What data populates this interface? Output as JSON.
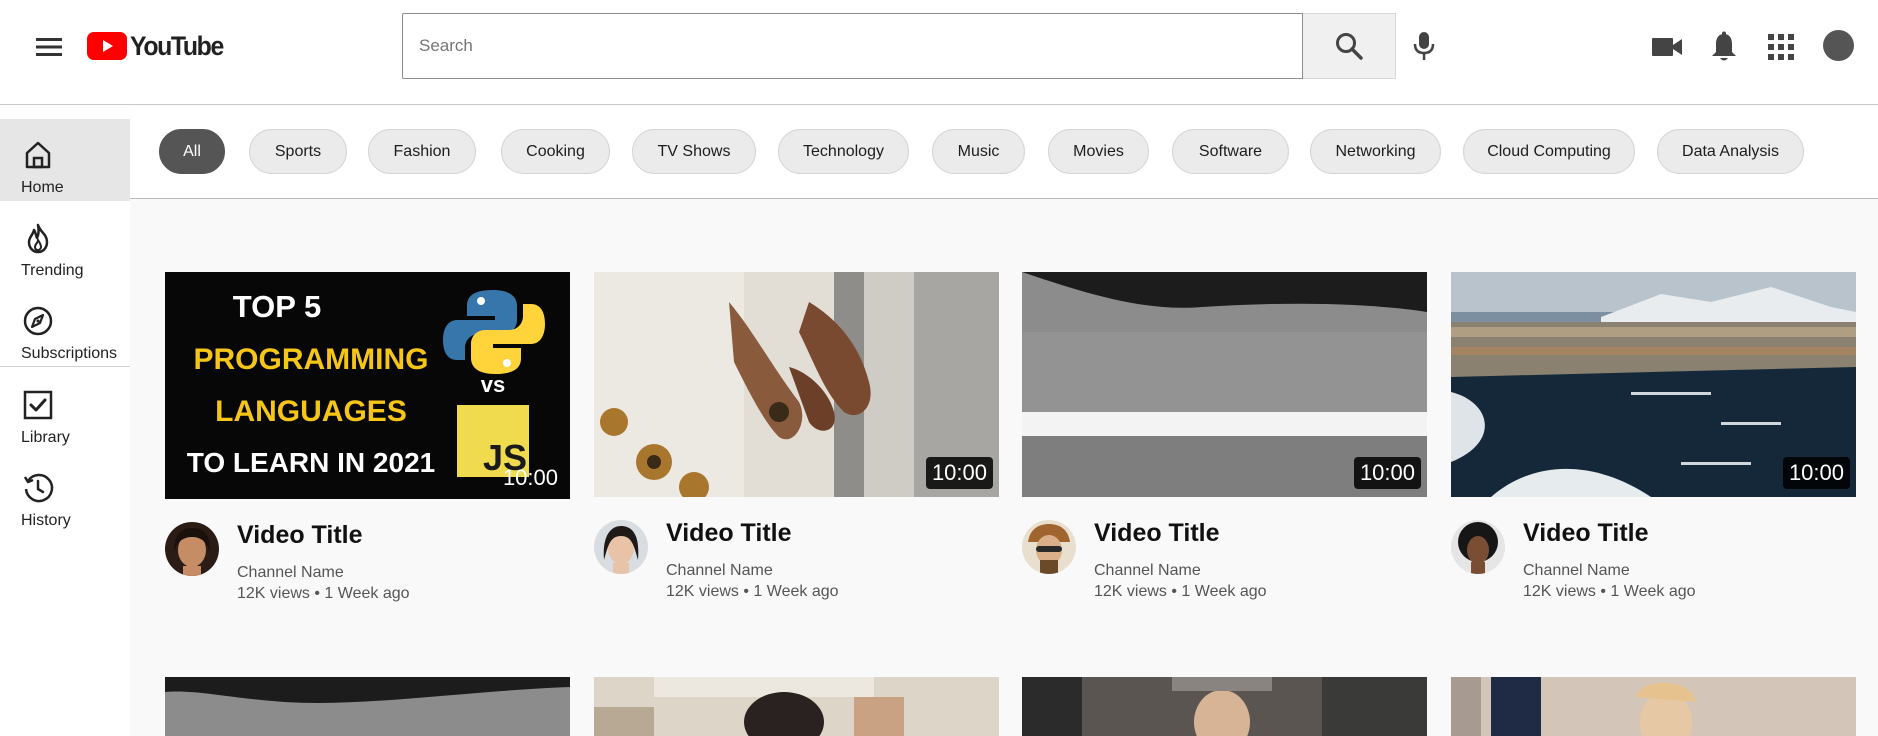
{
  "header": {
    "logo_text": "YouTube",
    "search_placeholder": "Search",
    "search_value": "",
    "icons": [
      "menu-icon",
      "youtube-logo-icon",
      "search-icon",
      "microphone-icon",
      "video-camera-icon",
      "bell-icon",
      "apps-grid-icon",
      "avatar"
    ]
  },
  "sidebar": {
    "items": [
      {
        "label": "Home",
        "icon": "home-icon",
        "active": true
      },
      {
        "label": "Trending",
        "icon": "flame-icon",
        "active": false
      },
      {
        "label": "Subscriptions",
        "icon": "compass-icon",
        "active": false
      },
      {
        "label": "Library",
        "icon": "library-check-icon",
        "active": false
      },
      {
        "label": "History",
        "icon": "history-icon",
        "active": false
      }
    ]
  },
  "chips": [
    {
      "label": "All",
      "active": true
    },
    {
      "label": "Sports",
      "active": false
    },
    {
      "label": "Fashion",
      "active": false
    },
    {
      "label": "Cooking",
      "active": false
    },
    {
      "label": "TV Shows",
      "active": false
    },
    {
      "label": "Technology",
      "active": false
    },
    {
      "label": "Music",
      "active": false
    },
    {
      "label": "Movies",
      "active": false
    },
    {
      "label": "Software",
      "active": false
    },
    {
      "label": "Networking",
      "active": false
    },
    {
      "label": "Cloud Computing",
      "active": false
    },
    {
      "label": "Data Analysis",
      "active": false
    }
  ],
  "videos": [
    {
      "title": "Video Title",
      "channel": "Channel Name",
      "meta": "12K views • 1 Week ago",
      "duration": "10:00",
      "thumbnail": {
        "kind": "programming-languages-banner",
        "lines": [
          "TOP 5",
          "PROGRAMMING",
          "LANGUAGES",
          "TO LEARN IN 2021"
        ],
        "badge_text": "vs",
        "logo_text": "JS"
      }
    },
    {
      "title": "Video Title",
      "channel": "Channel Name",
      "meta": "12K views • 1 Week ago",
      "duration": "10:00",
      "thumbnail": {
        "kind": "holding-hands-photo"
      }
    },
    {
      "title": "Video Title",
      "channel": "Channel Name",
      "meta": "12K views • 1 Week ago",
      "duration": "10:00",
      "thumbnail": {
        "kind": "road-line-photo"
      }
    },
    {
      "title": "Video Title",
      "channel": "Channel Name",
      "meta": "12K views • 1 Week ago",
      "duration": "10:00",
      "thumbnail": {
        "kind": "harbor-town-photo"
      }
    }
  ],
  "second_row_thumbnails": [
    "road-photo",
    "person-photo",
    "gym-photo",
    "woman-photo"
  ],
  "colors": {
    "brand_red": "#ff0000",
    "chip_active": "#555555",
    "chip_bg": "#ebebeb",
    "sidebar_active": "#e6e6e6",
    "text_primary": "#111111",
    "text_secondary": "#555555"
  }
}
